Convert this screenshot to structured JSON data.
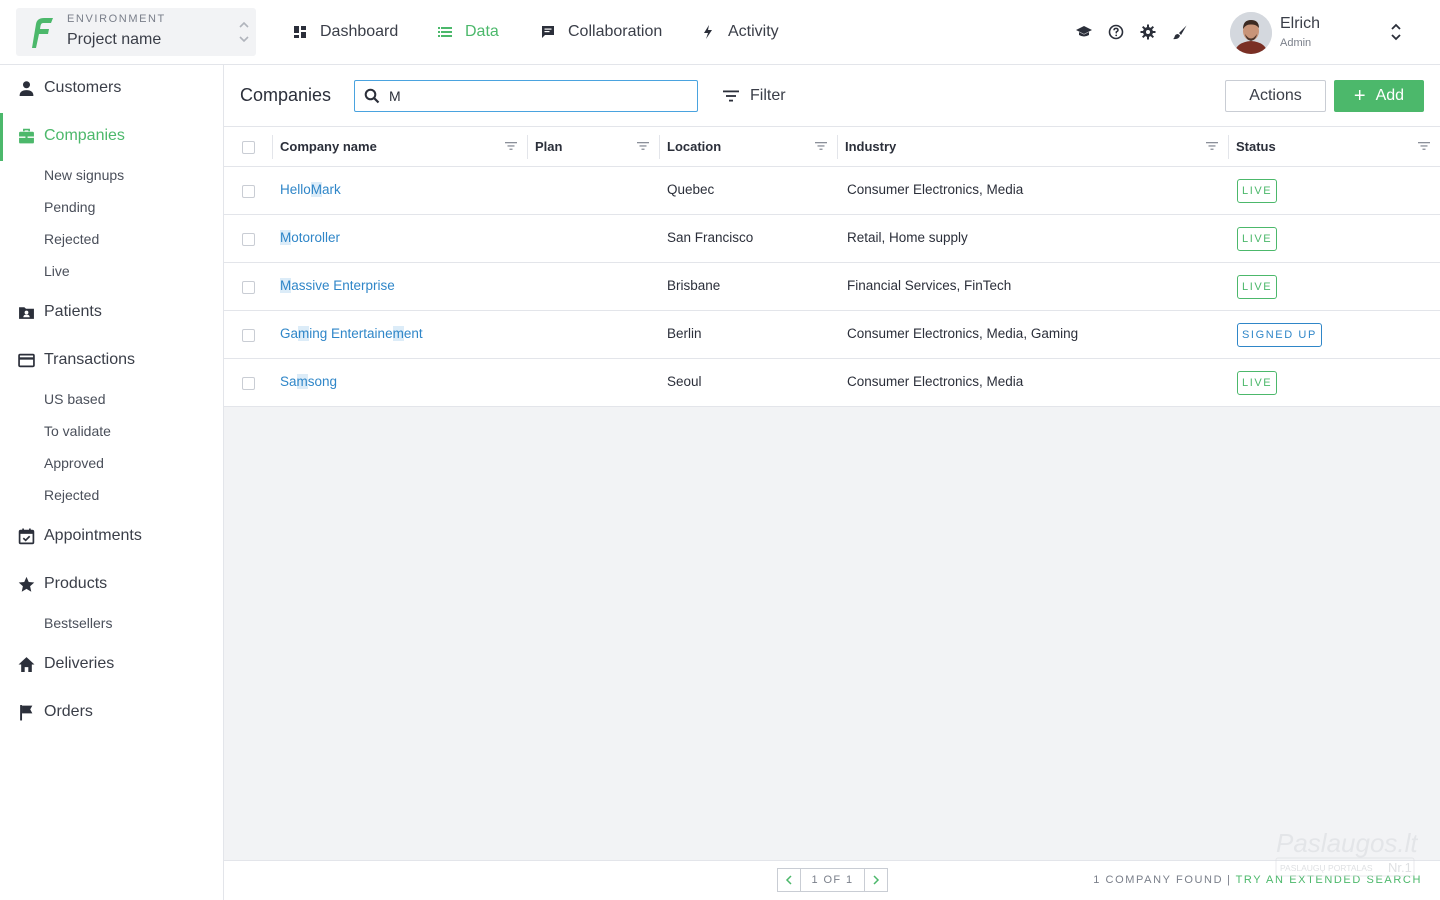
{
  "environment": {
    "label": "ENVIRONMENT",
    "value": "Project name"
  },
  "nav": [
    {
      "label": "Dashboard",
      "icon": "dashboard-icon"
    },
    {
      "label": "Data",
      "icon": "list-icon",
      "active": true
    },
    {
      "label": "Collaboration",
      "icon": "chat-icon"
    },
    {
      "label": "Activity",
      "icon": "bolt-icon"
    }
  ],
  "tools": [
    "graduation-cap-icon",
    "help-icon",
    "gear-icon",
    "brush-icon"
  ],
  "user": {
    "name": "Elrich",
    "role": "Admin"
  },
  "sidebar": {
    "items": [
      {
        "label": "Customers",
        "icon": "person-icon"
      },
      {
        "label": "Companies",
        "icon": "briefcase-icon",
        "active": true
      },
      {
        "label": "Patients",
        "icon": "contact-folder-icon"
      },
      {
        "label": "Transactions",
        "icon": "credit-card-icon"
      },
      {
        "label": "Appointments",
        "icon": "calendar-check-icon"
      },
      {
        "label": "Products",
        "icon": "star-icon"
      },
      {
        "label": "Deliveries",
        "icon": "home-icon"
      },
      {
        "label": "Orders",
        "icon": "flag-icon"
      }
    ],
    "companies_sub": [
      "New signups",
      "Pending",
      "Rejected",
      "Live"
    ],
    "transactions_sub": [
      "US based",
      "To validate",
      "Approved",
      "Rejected"
    ],
    "products_sub": [
      "Bestsellers"
    ]
  },
  "toolbar": {
    "title": "Companies",
    "search_value": "M",
    "filter_label": "Filter",
    "actions_label": "Actions",
    "add_label": "Add"
  },
  "table": {
    "columns": [
      "Company name",
      "Plan",
      "Location",
      "Industry",
      "Status"
    ],
    "rows": [
      {
        "name_parts": [
          "Hello",
          "M",
          "ark"
        ],
        "plan": "",
        "location": "Quebec",
        "industry": "Consumer Electronics, Media",
        "status": "LIVE"
      },
      {
        "name_parts": [
          "",
          "M",
          "otoroller"
        ],
        "plan": "",
        "location": "San Francisco",
        "industry": "Retail, Home supply",
        "status": "LIVE"
      },
      {
        "name_parts": [
          "",
          "M",
          "assive Enterprise"
        ],
        "plan": "",
        "location": "Brisbane",
        "industry": "Financial Services, FinTech",
        "status": "LIVE"
      },
      {
        "name_parts": [
          "Ga",
          "m",
          "ing Entertaine",
          "m",
          "ent"
        ],
        "plan": "",
        "location": "Berlin",
        "industry": "Consumer Electronics, Media, Gaming",
        "status": "SIGNED UP"
      },
      {
        "name_parts": [
          "Sa",
          "m",
          "song"
        ],
        "plan": "",
        "location": "Seoul",
        "industry": "Consumer Electronics, Media",
        "status": "LIVE"
      }
    ]
  },
  "footer": {
    "page_info": "1 OF 1",
    "found_text": "1 COMPANY FOUND",
    "separator": "|",
    "extended_link": "TRY AN EXTENDED SEARCH"
  },
  "watermark": {
    "brand": "Paslaugos.lt",
    "tagline": "PASLAUGŲ PORTALAS",
    "rank": "Nr.1"
  },
  "colors": {
    "accent": "#4cb86b",
    "link": "#2f86c8",
    "highlight": "#dcecf8",
    "focus": "#4aa3df"
  }
}
